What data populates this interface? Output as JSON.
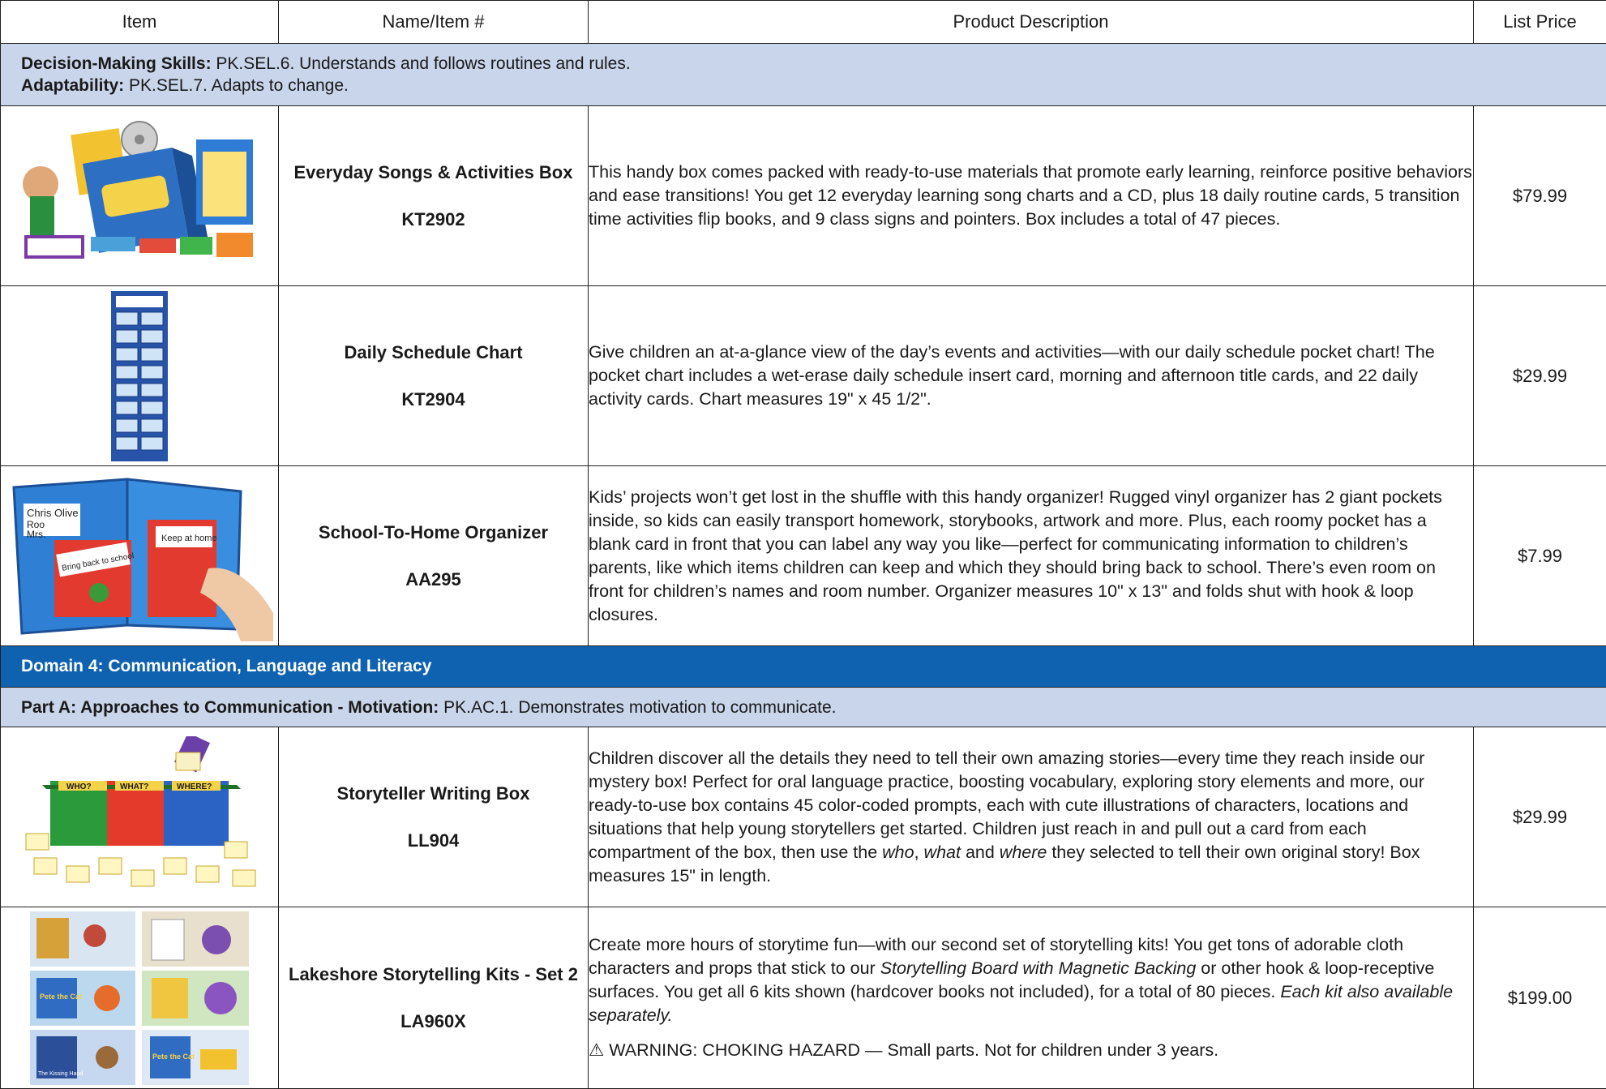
{
  "header": {
    "col_item": "Item",
    "col_name": "Name/Item #",
    "col_desc": "Product Description",
    "col_price": "List Price"
  },
  "section1": {
    "line1_label": "Decision-Making Skills:",
    "line1_text": " PK.SEL.6. Understands and follows routines and rules.",
    "line2_label": "Adaptability:",
    "line2_text": " PK.SEL.7. Adapts to change."
  },
  "products": [
    {
      "name": "Everyday Songs & Activities Box",
      "code": "KT2902",
      "description": "This handy box comes packed with ready-to-use materials that promote early learning, reinforce positive behaviors and ease transitions! You get 12 everyday learning song charts and a CD, plus 18 daily routine cards, 5 transition time activities flip books, and 9 class signs and pointers. Box includes a total of 47 pieces.",
      "price": "$79.99",
      "image_icon": "songs-activities-box-icon"
    },
    {
      "name": "Daily Schedule Chart",
      "code": "KT2904",
      "description": "Give children an at-a-glance view of the day’s events and activities—with our daily schedule pocket chart! The pocket chart includes a wet-erase daily schedule insert card, morning and afternoon title cards, and 22 daily activity cards. Chart measures 19\" x 45 1/2\".",
      "price": "$29.99",
      "image_icon": "pocket-chart-icon"
    },
    {
      "name": "School-To-Home Organizer",
      "code": "AA295",
      "description": "Kids’ projects won’t get lost in the shuffle with this handy organizer! Rugged vinyl organizer has 2 giant pockets inside, so kids can easily transport homework, storybooks, artwork and more. Plus, each roomy pocket has a blank card in front that you can label any way you like—perfect for communicating information to children’s parents, like which items children can keep and which they should bring back to school. There’s even room on front for children’s names and room number. Organizer measures 10\" x 13\" and folds shut with hook & loop closures.",
      "price": "$7.99",
      "image_icon": "organizer-folder-icon",
      "image_texts": [
        "Chris Olive",
        "Roo",
        "Mrs.",
        "Bring back to school",
        "Keep at home"
      ]
    },
    {
      "name": "Storyteller Writing Box",
      "code": "LL904",
      "description_parts": [
        "Children discover all the details they need to tell their own amazing stories—every time they reach inside our mystery box! Perfect for oral language practice, boosting vocabulary, exploring story elements and more, our ready-to-use box contains 45 color-coded prompts, each with cute illustrations of characters, locations and situations that help young storytellers get started. Children just reach in and pull out a card from each compartment of the box, then use the ",
        "who",
        ", ",
        "what",
        " and ",
        "where",
        " they selected to tell their own original story! Box measures 15\" in length."
      ],
      "price": "$29.99",
      "image_icon": "storyteller-box-icon",
      "image_texts": [
        "WHO?",
        "WHAT?",
        "WHERE?"
      ]
    },
    {
      "name": "Lakeshore Storytelling Kits - Set 2",
      "code": "LA960X",
      "description_parts": [
        "Create more hours of storytime fun—with our second set of storytelling kits! You get tons of adorable cloth characters and props that stick to our ",
        "Storytelling Board with Magnetic Backing",
        " or other hook & loop-receptive surfaces. You get all 6 kits shown (hardcover books not included), for a total of 80 pieces. ",
        "Each kit also available separately."
      ],
      "warning": "⚠ WARNING: CHOKING HAZARD — Small parts. Not for children under 3 years.",
      "price": "$199.00",
      "image_icon": "storytelling-kits-icon",
      "image_texts": [
        "Pete the Cat",
        "Pete the Cat",
        "The Kissing Hand"
      ]
    }
  ],
  "section2": {
    "title": "Domain 4: Communication, Language and Literacy"
  },
  "section3": {
    "label": "Part A: Approaches to Communication - Motivation:",
    "text": " PK.AC.1. Demonstrates motivation to communicate."
  },
  "colors": {
    "header_light": "#c9d5ea",
    "header_dark": "#0f62b0",
    "border": "#1e1e1e"
  }
}
